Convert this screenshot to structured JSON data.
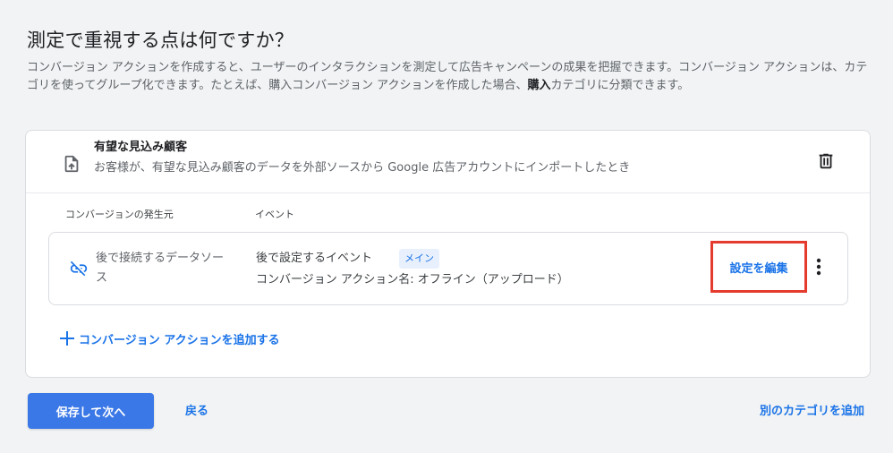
{
  "page": {
    "title": "測定で重視する点は何ですか？",
    "description_part1": "コンバージョン アクションを作成すると、ユーザーのインタラクションを測定して広告キャンペーンの成果を把握できます。コンバージョン アクションは、カテゴリを使ってグループ化できます。たとえば、購入コンバージョン アクションを作成した場合、",
    "description_bold": "購入",
    "description_part2": "カテゴリに分類できます。"
  },
  "category": {
    "title": "有望な見込み顧客",
    "description": "お客様が、有望な見込み顧客のデータを外部ソースから Google 広告アカウントにインポートしたとき"
  },
  "table": {
    "columns": {
      "source": "コンバージョンの発生元",
      "event": "イベント"
    },
    "rows": [
      {
        "source": "後で接続するデータソース",
        "event_name": "後で設定するイベント",
        "badge": "メイン",
        "action_name": "コンバージョン アクション名: オフライン（アップロード）",
        "edit_label": "設定を編集"
      }
    ]
  },
  "actions": {
    "add_conversion_action": "コンバージョン アクションを追加する",
    "save_next": "保存して次へ",
    "back": "戻る",
    "add_category": "別のカテゴリを追加"
  },
  "icons": {
    "category": "upload-file-icon",
    "delete": "trash-icon",
    "source": "link-off-icon",
    "more": "more-vert-icon",
    "add": "plus-icon"
  },
  "colors": {
    "accent": "#1a73e8",
    "primary_button": "#3b78e7",
    "highlight_border": "#e53b2f",
    "badge_bg": "#e8f0fe",
    "background": "#f1f3f4"
  }
}
